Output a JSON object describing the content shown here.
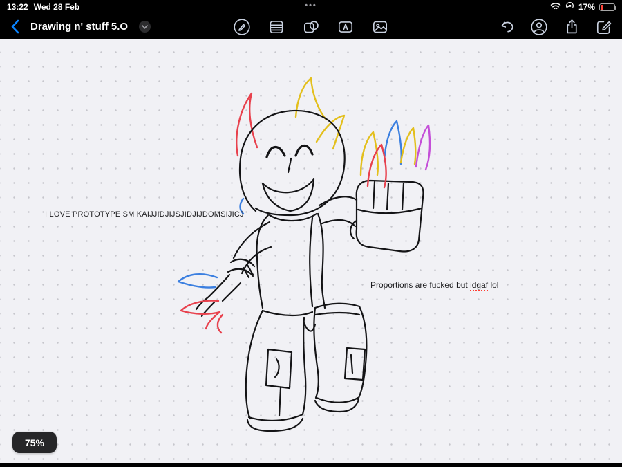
{
  "status_bar": {
    "time": "13:22",
    "date": "Wed 28 Feb",
    "multitask_dots": "•••",
    "battery_percent": "17%",
    "battery_level": 0.17,
    "icons": [
      "wifi-icon",
      "rotation-lock-icon",
      "battery-icon"
    ]
  },
  "nav": {
    "title": "Drawing n' stuff 5.O",
    "back_icon": "chevron-left-icon",
    "title_menu_icon": "chevron-down-icon",
    "center_tools": [
      {
        "name": "markup-pen-button",
        "icon": "pen-circle-icon"
      },
      {
        "name": "paper-style-button",
        "icon": "lined-paper-icon"
      },
      {
        "name": "shapes-button",
        "icon": "shapes-icon"
      },
      {
        "name": "text-box-button",
        "icon": "text-box-icon"
      },
      {
        "name": "photos-button",
        "icon": "photos-icon"
      }
    ],
    "right_tools": [
      {
        "name": "undo-button",
        "icon": "undo-icon"
      },
      {
        "name": "collaborate-button",
        "icon": "person-circle-icon"
      },
      {
        "name": "share-button",
        "icon": "share-icon"
      },
      {
        "name": "compose-button",
        "icon": "compose-icon"
      }
    ]
  },
  "canvas": {
    "note1": "I LOVE PROTOTYPE SM KAIJJIDJIJSJIDJIJDOMSIJICJ",
    "note2_prefix": "Proportions are fucked but ",
    "note2_underlined": "idgaf",
    "note2_suffix": " lol",
    "zoom_label": "75%"
  },
  "colors": {
    "accent_blue": "#0a84ff",
    "toolbar_icon": "#c9d1e0",
    "low_battery_red": "#ff453a",
    "canvas_bg": "#f1f1f5",
    "sketch_black": "#141416",
    "sketch_red": "#e8414d",
    "sketch_yellow": "#e3bf1c",
    "sketch_blue": "#3b7fe0",
    "sketch_purple": "#c44fd8"
  }
}
